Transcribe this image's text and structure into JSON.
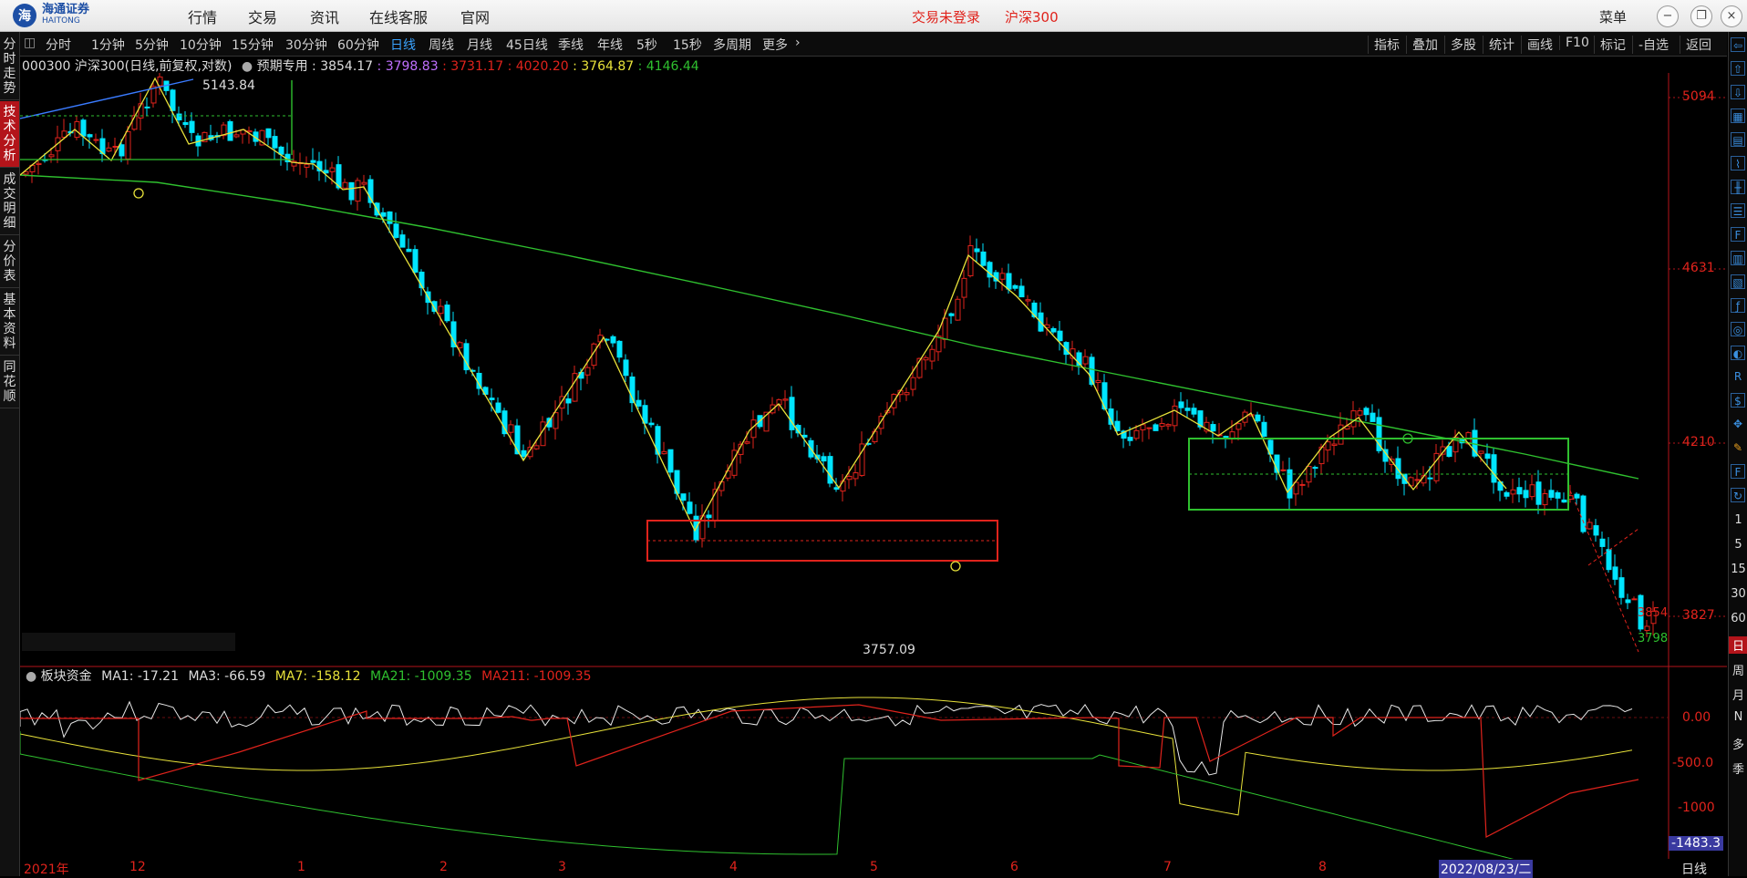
{
  "app": {
    "logo_cn": "海通证券",
    "logo_en": "HAITONG",
    "top_menu": [
      "行情",
      "交易",
      "资讯",
      "在线客服",
      "官网"
    ],
    "login_status": "交易未登录",
    "symbol_title": "沪深300",
    "menu_label": "菜单",
    "win_buttons": [
      "−",
      "❐",
      "□",
      "×"
    ]
  },
  "toolbar": {
    "periods": [
      "分时",
      "1分钟",
      "5分钟",
      "10分钟",
      "15分钟",
      "30分钟",
      "60分钟",
      "日线",
      "周线",
      "月线",
      "45日线",
      "季线",
      "年线",
      "5秒",
      "15秒",
      "多周期",
      "更多"
    ],
    "active_period": "日线",
    "right_tools": [
      "指标",
      "叠加",
      "多股",
      "统计",
      "画线",
      "F10",
      "标记",
      "-自选",
      "返回"
    ]
  },
  "left_tabs": [
    "分时走势",
    "技术分析",
    "成交明细",
    "分价表",
    "基本资料",
    "同花顺"
  ],
  "right_numbers": [
    "1",
    "5",
    "15",
    "30",
    "60",
    "日",
    "周",
    "月",
    "N",
    "多",
    "季"
  ],
  "info": {
    "code_name": "000300 沪深300(日线,前复权,对数)",
    "label": "预期专用",
    "v1": ": 3854.17",
    "v2": ": 3798.83",
    "v3": ": 3731.17",
    "v4": ": 4020.20",
    "v5": ": 3764.87",
    "v6": ": 4146.44"
  },
  "price_axis": [
    "5094",
    "4631",
    "4210",
    "3827"
  ],
  "annotations": {
    "high": "5143.84",
    "low": "3757.09",
    "last_red": "3854",
    "last_green": "3798"
  },
  "indicator": {
    "name": "板块资金",
    "ma1": "MA1: -17.21",
    "ma3": "MA3: -66.59",
    "ma7": "MA7: -158.12",
    "ma21": "MA21: -1009.35",
    "ma211": "MA211: -1009.35",
    "axis": [
      "0.00",
      "-500.0",
      "-1000"
    ],
    "current": "-1483.3"
  },
  "x_axis": {
    "labels": [
      "2021年",
      "12",
      "1",
      "2",
      "3",
      "4",
      "5",
      "6",
      "7",
      "8"
    ],
    "cursor_date": "2022/08/23/二",
    "period_label": "日线"
  },
  "colors": {
    "up": "#e0231c",
    "down": "#00e5ff",
    "accent": "#3aa3ff",
    "ma_long": "#2fc02f",
    "zigzag": "#e8e23a"
  },
  "chart_data": {
    "type": "candlestick",
    "price_range": [
      3700,
      5200
    ],
    "log_scale": true,
    "x_months": [
      "2021-11",
      "2021-12",
      "2022-01",
      "2022-02",
      "2022-03",
      "2022-04",
      "2022-05",
      "2022-06",
      "2022-07",
      "2022-08"
    ],
    "zigzag_close": [
      4800,
      5143.84,
      4820,
      4930,
      4650,
      4120,
      4300,
      3757.09,
      4000,
      4480,
      4100,
      4220,
      3980,
      4250,
      3880
    ]
  }
}
